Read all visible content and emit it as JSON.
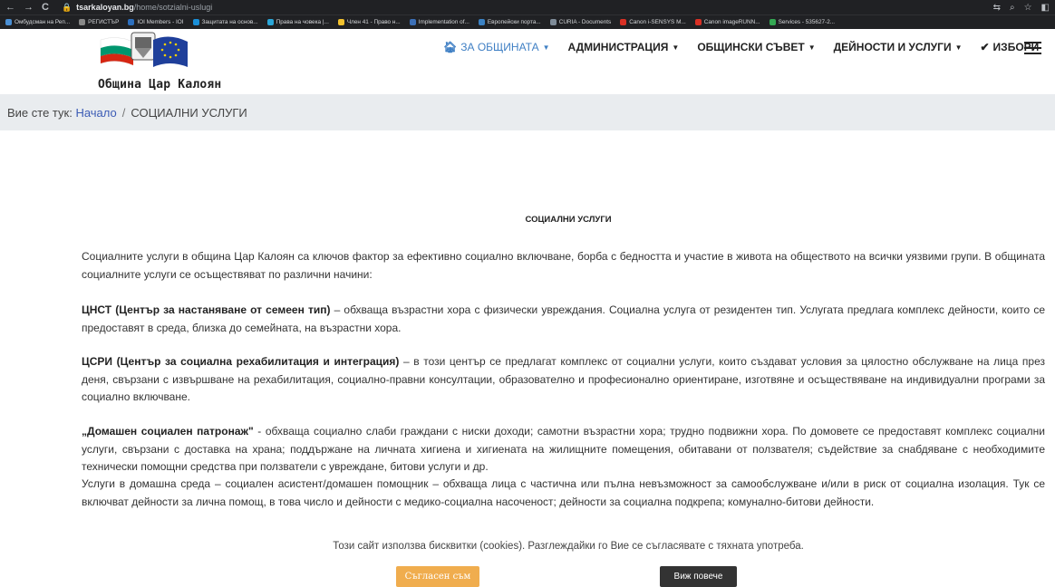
{
  "browser": {
    "nav": [
      "←",
      "→",
      "C"
    ],
    "url_domain": "tsarkaloyan.bg",
    "url_path": "/home/sotzialni-uslugi",
    "bookmarks": [
      {
        "label": "Омбудсман на Реп...",
        "color": "#4a8fd4"
      },
      {
        "label": "РЕГИСТЪР",
        "color": "#888888"
      },
      {
        "label": "IOI Members - IOI",
        "color": "#2c6fbe"
      },
      {
        "label": "Защитата на основ...",
        "color": "#1a8fd8"
      },
      {
        "label": "Права на човека |...",
        "color": "#2aa6d8"
      },
      {
        "label": "Член 41 - Право н...",
        "color": "#f2c12e"
      },
      {
        "label": "Implementation of...",
        "color": "#3b6fb6"
      },
      {
        "label": "Европейски порта...",
        "color": "#3b82c4"
      },
      {
        "label": "CURIA - Documents",
        "color": "#7f8c99"
      },
      {
        "label": "Canon i-SENSYS M...",
        "color": "#d93025"
      },
      {
        "label": "Canon imageRUNN...",
        "color": "#d93025"
      },
      {
        "label": "Services - 535627-2...",
        "color": "#34a853"
      }
    ]
  },
  "site": {
    "logo_text": "Община Цар Калоян",
    "menu": [
      {
        "label": "ЗА ОБЩИНАТА",
        "icon": "home-icon",
        "dropdown": true,
        "active": true
      },
      {
        "label": "АДМИНИСТРАЦИЯ",
        "dropdown": true
      },
      {
        "label": "ОБЩИНСКИ СЪВЕТ",
        "dropdown": true
      },
      {
        "label": "ДЕЙНОСТИ И УСЛУГИ",
        "dropdown": true
      },
      {
        "label": "ИЗБОРИ",
        "icon": "check-icon",
        "dropdown": false
      }
    ]
  },
  "breadcrumb": {
    "prefix": "Вие сте тук:",
    "home": "Начало",
    "separator": "/",
    "current": "СОЦИАЛНИ УСЛУГИ"
  },
  "content": {
    "title": "СОЦИАЛНИ УСЛУГИ",
    "intro": "Социалните услуги в община Цар Калоян са ключов фактор за ефективно социално включване, борба с бедността и участие в живота на обществото на всички уязвими групи. В общината социалните услуги се осъществяват по различни начини:",
    "p1_bold": "ЦНСТ (Център за настаняване от семеен тип)",
    "p1_text": " – обхваща възрастни хора с физически увреждания. Социална услуга от резидентен тип. Услугата предлага комплекс дейности, които се предоставят в среда, близка до семейната, на възрастни хора.",
    "p2_bold": "ЦСРИ (Център за социална рехабилитация и интеграция)",
    "p2_text": " – в този център се предлагат комплекс от социални услуги, които създават условия за цялостно обслужване на лица през деня, свързани с извършване на рехабилитация, социално-правни консултации, образователно и професионално ориентиране, изготвяне и осъществяване  на индивидуални програми за социално включване.",
    "p3_bold": "„Домашен социален патронаж\"",
    "p3_text": " - обхваща социално слаби граждани с ниски доходи; самотни възрастни хора; трудно подвижни хора. По домовете се предоставят комплекс социални услуги, свързани с доставка на храна; поддържане на личната хигиена и хигиената на жилищните помещения, обитавани от ползвателя; съдействие за снабдяване с необходимите технически помощни средства при ползватели с увреждане, битови услуги и др.",
    "p4_text": "Услуги в домашна среда – социален асистент/домашен помощник – обхваща лица с частична или пълна невъзможност за самообслужване и/или в риск от социална изолация. Тук се включват дейности за лична помощ, в това число и дейности с медико-социална насоченост; дейности за социална подкрепа; комунално-битови дейности."
  },
  "cookie": {
    "text": "Този сайт използва бисквитки (cookies). Разглеждайки го Вие се съгласявате с тяхната употреба.",
    "agree": "Съгласен съм",
    "more": "Виж повече"
  }
}
